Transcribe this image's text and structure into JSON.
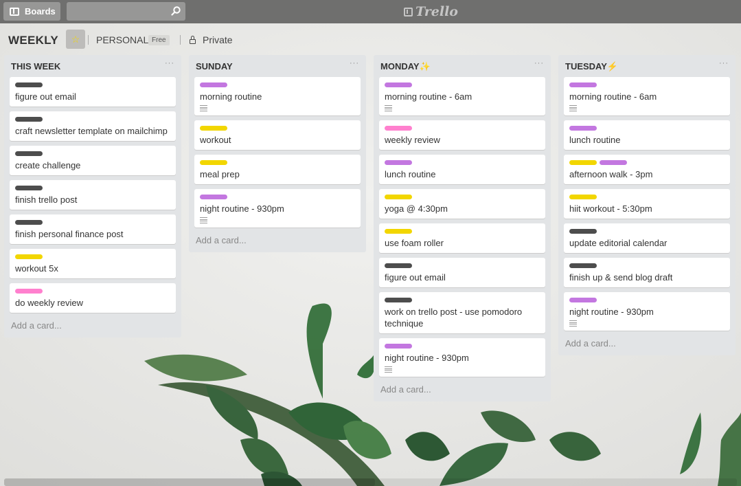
{
  "topbar": {
    "boards_label": "Boards",
    "search_value": "",
    "logo_text": "Trello"
  },
  "header": {
    "board_title": "WEEKLY",
    "team_name": "PERSONAL",
    "team_plan": "Free",
    "visibility": "Private"
  },
  "colors": {
    "dark": "#4d4d4d",
    "purple": "#c377e0",
    "pink": "#ff80ce",
    "yellow": "#f2d600"
  },
  "lists": [
    {
      "title": "THIS WEEK",
      "add_label": "Add a card...",
      "cards": [
        {
          "text": "figure out email",
          "labels": [
            "dark"
          ],
          "desc": false
        },
        {
          "text": "craft newsletter template on mailchimp",
          "labels": [
            "dark"
          ],
          "desc": false
        },
        {
          "text": "create challenge",
          "labels": [
            "dark"
          ],
          "desc": false
        },
        {
          "text": "finish trello post",
          "labels": [
            "dark"
          ],
          "desc": false
        },
        {
          "text": "finish personal finance post",
          "labels": [
            "dark"
          ],
          "desc": false
        },
        {
          "text": "workout 5x",
          "labels": [
            "yellow"
          ],
          "desc": false
        },
        {
          "text": "do weekly review",
          "labels": [
            "pink"
          ],
          "desc": false
        }
      ]
    },
    {
      "title": "SUNDAY",
      "add_label": "Add a card...",
      "cards": [
        {
          "text": "morning routine",
          "labels": [
            "purple"
          ],
          "desc": true
        },
        {
          "text": "workout",
          "labels": [
            "yellow"
          ],
          "desc": false
        },
        {
          "text": "meal prep",
          "labels": [
            "yellow"
          ],
          "desc": false
        },
        {
          "text": "night routine - 930pm",
          "labels": [
            "purple"
          ],
          "desc": true
        }
      ]
    },
    {
      "title": "MONDAY✨",
      "add_label": "Add a card...",
      "cards": [
        {
          "text": "morning routine - 6am",
          "labels": [
            "purple"
          ],
          "desc": true
        },
        {
          "text": "weekly review",
          "labels": [
            "pink"
          ],
          "desc": false
        },
        {
          "text": "lunch routine",
          "labels": [
            "purple"
          ],
          "desc": false
        },
        {
          "text": "yoga @ 4:30pm",
          "labels": [
            "yellow"
          ],
          "desc": false
        },
        {
          "text": "use foam roller",
          "labels": [
            "yellow"
          ],
          "desc": false
        },
        {
          "text": "figure out email",
          "labels": [
            "dark"
          ],
          "desc": false
        },
        {
          "text": "work on trello post - use pomodoro technique",
          "labels": [
            "dark"
          ],
          "desc": false
        },
        {
          "text": "night routine - 930pm",
          "labels": [
            "purple"
          ],
          "desc": true
        }
      ]
    },
    {
      "title": "TUESDAY⚡",
      "add_label": "Add a card...",
      "cards": [
        {
          "text": "morning routine - 6am",
          "labels": [
            "purple"
          ],
          "desc": true
        },
        {
          "text": "lunch routine",
          "labels": [
            "purple"
          ],
          "desc": false
        },
        {
          "text": "afternoon walk - 3pm",
          "labels": [
            "yellow",
            "purple"
          ],
          "desc": false
        },
        {
          "text": "hiit workout - 5:30pm",
          "labels": [
            "yellow"
          ],
          "desc": false
        },
        {
          "text": "update editorial calendar",
          "labels": [
            "dark"
          ],
          "desc": false
        },
        {
          "text": "finish up & send blog draft",
          "labels": [
            "dark"
          ],
          "desc": false
        },
        {
          "text": "night routine - 930pm",
          "labels": [
            "purple"
          ],
          "desc": true
        }
      ]
    }
  ]
}
